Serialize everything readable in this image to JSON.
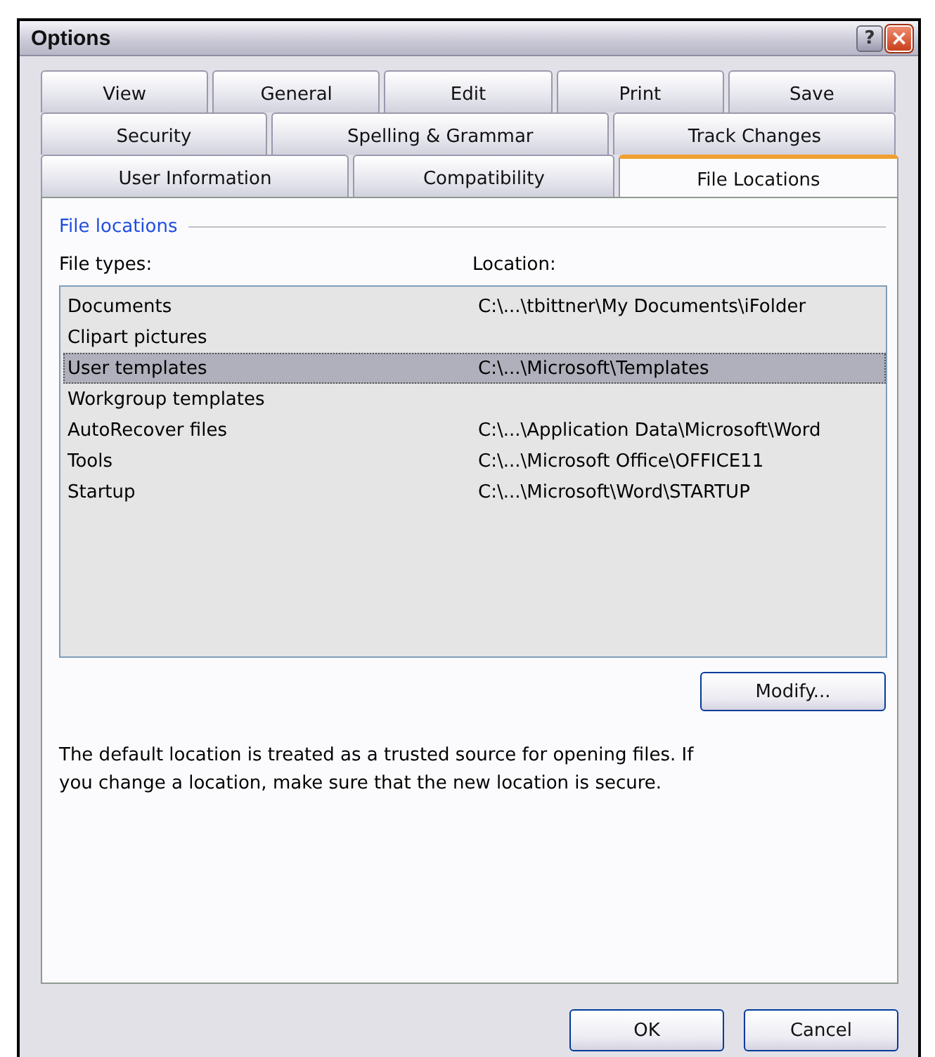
{
  "window": {
    "title": "Options"
  },
  "title_buttons": [
    {
      "kind": "help",
      "label": "?"
    },
    {
      "kind": "close",
      "label": "×"
    }
  ],
  "tab_rows": [
    [
      {
        "label": "View",
        "selected": false
      },
      {
        "label": "General",
        "selected": false
      },
      {
        "label": "Edit",
        "selected": false
      },
      {
        "label": "Print",
        "selected": false
      },
      {
        "label": "Save",
        "selected": false
      }
    ],
    [
      {
        "label": "Security",
        "selected": false
      },
      {
        "label": "Spelling & Grammar",
        "selected": false
      },
      {
        "label": "Track Changes",
        "selected": false
      }
    ],
    [
      {
        "label": "User Information",
        "selected": false
      },
      {
        "label": "Compatibility",
        "selected": false
      },
      {
        "label": "File Locations",
        "selected": true
      }
    ]
  ],
  "group": {
    "title": "File locations"
  },
  "list": {
    "columns": [
      "File types:",
      "Location:"
    ],
    "rows": [
      {
        "type": "Documents",
        "location": "C:\\...\\tbittner\\My Documents\\iFolder",
        "selected": false
      },
      {
        "type": "Clipart pictures",
        "selected": false
      },
      {
        "type": "User templates",
        "location": "C:\\...\\Microsoft\\Templates",
        "selected": true
      },
      {
        "type": "Workgroup templates",
        "selected": false
      },
      {
        "type": "AutoRecover files",
        "location": "C:\\...\\Application Data\\Microsoft\\Word",
        "selected": false
      },
      {
        "type": "Tools",
        "location": "C:\\...\\Microsoft Office\\OFFICE11",
        "selected": false
      },
      {
        "type": "Startup",
        "location": "C:\\...\\Microsoft\\Word\\STARTUP",
        "selected": false
      }
    ]
  },
  "modify_button": "Modify...",
  "note": "The default location is treated as a trusted source for opening files. If you change a location, make sure that the new location is secure.",
  "buttons": [
    "OK",
    "Cancel"
  ]
}
